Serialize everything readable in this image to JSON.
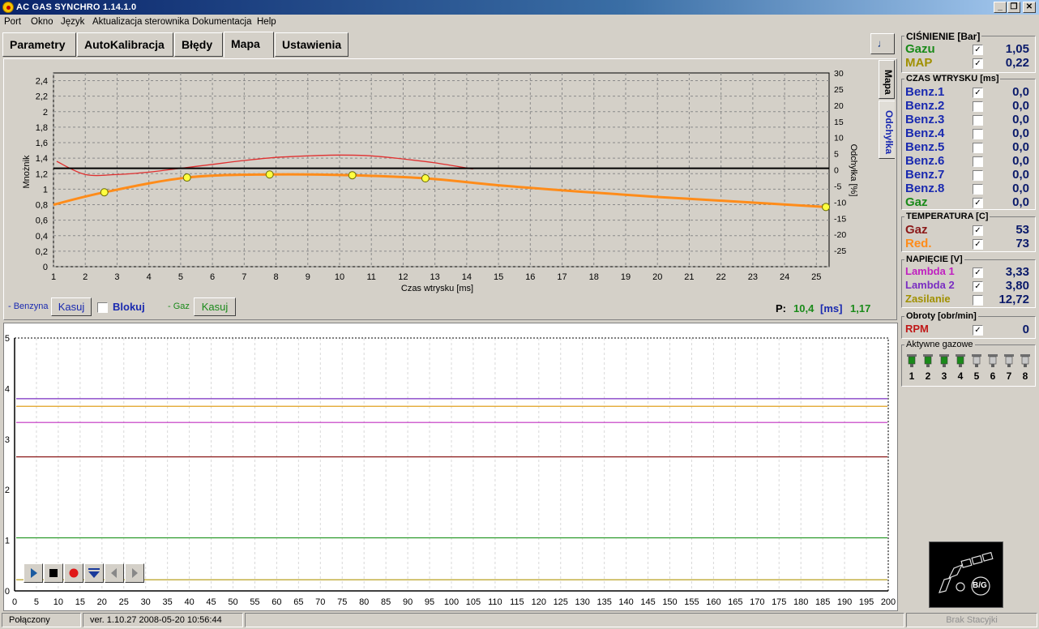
{
  "window": {
    "title": "AC GAS SYNCHRO   1.14.1.0",
    "minimize": "_",
    "maximize": "❐",
    "close": "✕"
  },
  "menu": [
    "Port",
    "Okno",
    "Język",
    "Aktualizacja sterownika",
    "Dokumentacja",
    "Help"
  ],
  "tabs": [
    "Parametry",
    "AutoKalibracja",
    "Błędy",
    "Mapa",
    "Ustawienia"
  ],
  "active_tab": "Mapa",
  "side_tabs": [
    "Mapa",
    "Odchyłka"
  ],
  "map_controls": {
    "benzyna_label": "- Benzyna",
    "kasuj_benz": "Kasuj",
    "blokuj": "Blokuj",
    "gaz_label": "- Gaz",
    "kasuj_gaz": "Kasuj",
    "p_label": "P:",
    "p_value": "10,4",
    "p_unit": "[ms]",
    "p_mult": "1,17"
  },
  "chart_data": [
    {
      "type": "line",
      "xlabel": "Czas wtrysku [ms]",
      "ylabel": "Mnożnik",
      "y2label": "Odchyłka [%]",
      "xlim": [
        1,
        25.4
      ],
      "ylim": [
        0,
        2.5
      ],
      "y2lim": [
        -30,
        30
      ],
      "x_ticks": [
        1,
        2,
        3,
        4,
        5,
        6,
        7,
        8,
        9,
        10,
        11,
        12,
        13,
        14,
        15,
        16,
        17,
        18,
        19,
        20,
        21,
        22,
        23,
        24,
        25
      ],
      "y_ticks": [
        "0",
        "0,2",
        "0,4",
        "0,6",
        "0,8",
        "1",
        "1,2",
        "1,4",
        "1,6",
        "1,8",
        "2",
        "2,2",
        "2,4"
      ],
      "y2_ticks": [
        "30",
        "25",
        "20",
        "15",
        "10",
        "5",
        "0",
        "-5",
        "-10",
        "-15",
        "-20",
        "-25"
      ],
      "grid": true,
      "series": [
        {
          "color": "#ff8c1a",
          "x": [
            1,
            2.6,
            5.2,
            7.8,
            10.4,
            12.7,
            15,
            17.5,
            20,
            22.5,
            25.3
          ],
          "y": [
            0.8,
            0.96,
            1.15,
            1.19,
            1.18,
            1.14,
            1.05,
            0.97,
            0.9,
            0.84,
            0.77
          ]
        },
        {
          "color": "#e03030",
          "x": [
            1.1,
            2,
            3,
            4,
            5,
            6,
            7,
            8,
            9,
            10,
            11,
            12,
            13,
            14.2
          ],
          "y": [
            1.36,
            1.19,
            1.19,
            1.22,
            1.27,
            1.32,
            1.37,
            1.41,
            1.43,
            1.44,
            1.43,
            1.39,
            1.34,
            1.26
          ]
        },
        {
          "color": "#000000",
          "x": [
            1,
            25.4
          ],
          "y": [
            1.27,
            1.27
          ]
        }
      ],
      "markers": {
        "x": [
          2.6,
          5.2,
          7.8,
          10.4,
          12.7,
          25.3
        ],
        "y": [
          0.96,
          1.15,
          1.19,
          1.18,
          1.14,
          0.77
        ]
      }
    },
    {
      "type": "line",
      "xlim": [
        0,
        200
      ],
      "ylim": [
        0,
        5
      ],
      "x_ticks": [
        0,
        5,
        10,
        15,
        20,
        25,
        30,
        35,
        40,
        45,
        50,
        55,
        60,
        65,
        70,
        75,
        80,
        85,
        90,
        95,
        100,
        105,
        110,
        115,
        120,
        125,
        130,
        135,
        140,
        145,
        150,
        155,
        160,
        165,
        170,
        175,
        180,
        185,
        190,
        195,
        200
      ],
      "y_ticks": [
        0,
        1,
        2,
        3,
        4,
        5
      ],
      "grid": true,
      "series": [
        {
          "color": "#7a2ec2",
          "level": 3.8
        },
        {
          "color": "#e0a020",
          "level": 3.65
        },
        {
          "color": "#c030c0",
          "level": 3.33
        },
        {
          "color": "#8b1a1a",
          "level": 2.65
        },
        {
          "color": "#2a9a2a",
          "level": 1.05
        },
        {
          "color": "#b8a020",
          "level": 0.22
        }
      ]
    }
  ],
  "right_panel": {
    "pressure": {
      "title": "CIŚNIENIE [Bar]",
      "rows": [
        {
          "label": "Gazu",
          "value": "1,05",
          "color": "#1a8a1a",
          "checked": true
        },
        {
          "label": "MAP",
          "value": "0,22",
          "color": "#a09000",
          "checked": true
        }
      ]
    },
    "injection": {
      "title": "CZAS WTRYSKU  [ms]",
      "rows": [
        {
          "label": "Benz.1",
          "value": "0,0",
          "color": "#1a2ab0",
          "checked": true
        },
        {
          "label": "Benz.2",
          "value": "0,0",
          "color": "#1a2ab0",
          "checked": false
        },
        {
          "label": "Benz.3",
          "value": "0,0",
          "color": "#1a2ab0",
          "checked": false
        },
        {
          "label": "Benz.4",
          "value": "0,0",
          "color": "#1a2ab0",
          "checked": false
        },
        {
          "label": "Benz.5",
          "value": "0,0",
          "color": "#1a2ab0",
          "checked": false
        },
        {
          "label": "Benz.6",
          "value": "0,0",
          "color": "#1a2ab0",
          "checked": false
        },
        {
          "label": "Benz.7",
          "value": "0,0",
          "color": "#1a2ab0",
          "checked": false
        },
        {
          "label": "Benz.8",
          "value": "0,0",
          "color": "#1a2ab0",
          "checked": false
        },
        {
          "label": "Gaz",
          "value": "0,0",
          "color": "#1a8a1a",
          "checked": true
        }
      ]
    },
    "temperature": {
      "title": "TEMPERATURA  [C]",
      "rows": [
        {
          "label": "Gaz",
          "value": "53",
          "color": "#8b1a1a",
          "checked": true
        },
        {
          "label": "Red.",
          "value": "73",
          "color": "#ff8c1a",
          "checked": true
        }
      ]
    },
    "voltage": {
      "title": "NAPIĘCIE [V]",
      "rows": [
        {
          "label": "Lambda 1",
          "value": "3,33",
          "color": "#c020c0",
          "checked": true
        },
        {
          "label": "Lambda 2",
          "value": "3,80",
          "color": "#7a2ec2",
          "checked": true
        },
        {
          "label": "Zasilanie",
          "value": "12,72",
          "color": "#a09000",
          "checked": false
        }
      ]
    },
    "rpm": {
      "title": "Obroty [obr/min]",
      "rows": [
        {
          "label": "RPM",
          "value": "0",
          "color": "#c01818",
          "checked": true
        }
      ]
    },
    "injectors": {
      "title": "Aktywne gazowe",
      "labels": [
        "1",
        "2",
        "3",
        "4",
        "5",
        "6",
        "7",
        "8"
      ],
      "active": [
        true,
        true,
        true,
        true,
        false,
        false,
        false,
        false
      ]
    },
    "logo": {
      "text": "B/G"
    }
  },
  "status": {
    "connection": "Połączony",
    "version": "ver. 1.10.27  2008-05-20  10:56:44",
    "ignition": "Brak Stacyjki"
  }
}
